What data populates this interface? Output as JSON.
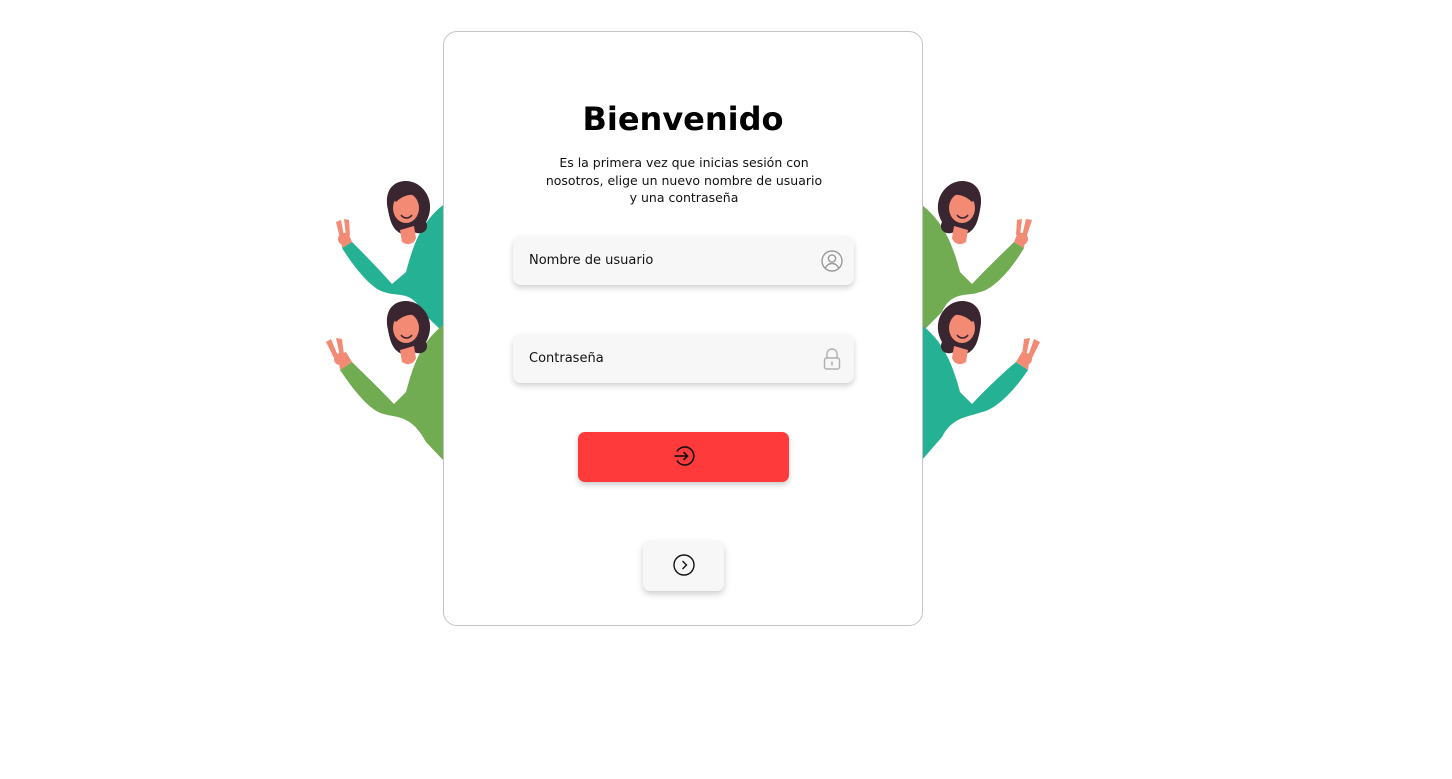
{
  "login": {
    "title": "Bienvenido",
    "subtitle": "Es la primera vez que inicias sesión con nosotros, elige un nuevo nombre de usuario y una contraseña",
    "username": {
      "placeholder": "Nombre de usuario",
      "value": "",
      "icon": "user-circle-icon"
    },
    "password": {
      "placeholder": "Contraseña",
      "value": "",
      "icon": "lock-icon"
    },
    "submit": {
      "icon": "arrow-right-circle-icon",
      "color": "#ff3a3a"
    },
    "next": {
      "icon": "chevron-right-circle-icon"
    }
  },
  "decoration": {
    "illustration": "waving-woman-peace-sign",
    "colors": {
      "teal": "#25b294",
      "green": "#71ab52",
      "hair": "#3a2630",
      "skin": "#f28a74"
    }
  }
}
